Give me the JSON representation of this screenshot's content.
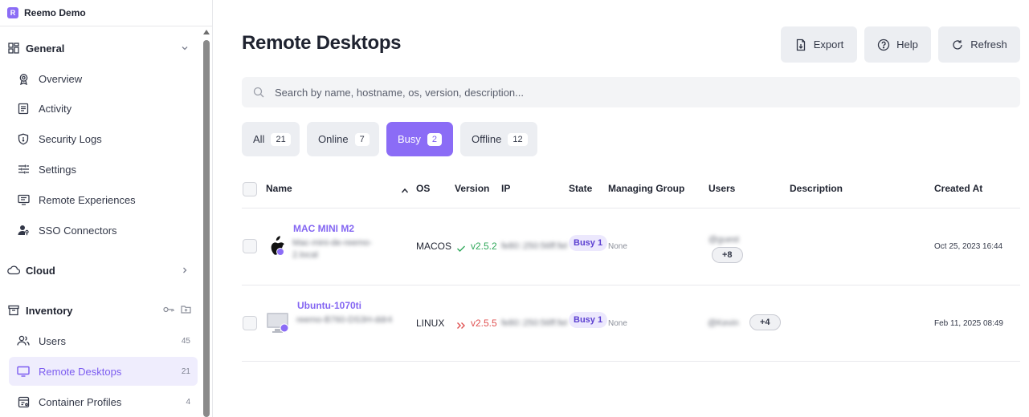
{
  "app": {
    "name": "Reemo Demo",
    "brand_color": "#8b6cf6"
  },
  "sidebar": {
    "general": {
      "label": "General",
      "items": [
        {
          "label": "Overview",
          "icon": "badge-icon"
        },
        {
          "label": "Activity",
          "icon": "document-list-icon"
        },
        {
          "label": "Security Logs",
          "icon": "shield-icon"
        },
        {
          "label": "Settings",
          "icon": "sliders-icon"
        },
        {
          "label": "Remote Experiences",
          "icon": "monitor-chat-icon"
        },
        {
          "label": "SSO Connectors",
          "icon": "user-key-icon"
        }
      ]
    },
    "cloud": {
      "label": "Cloud"
    },
    "inventory": {
      "label": "Inventory",
      "items": [
        {
          "label": "Users",
          "count": "45",
          "icon": "users-icon"
        },
        {
          "label": "Remote Desktops",
          "count": "21",
          "icon": "monitor-icon",
          "active": true
        },
        {
          "label": "Container Profiles",
          "count": "4",
          "icon": "container-icon"
        }
      ]
    }
  },
  "header": {
    "title": "Remote Desktops",
    "export_label": "Export",
    "help_label": "Help",
    "refresh_label": "Refresh"
  },
  "search": {
    "placeholder": "Search by name, hostname, os, version, description..."
  },
  "filters": [
    {
      "label": "All",
      "count": "21"
    },
    {
      "label": "Online",
      "count": "7"
    },
    {
      "label": "Busy",
      "count": "2",
      "active": true
    },
    {
      "label": "Offline",
      "count": "12"
    }
  ],
  "table": {
    "columns": {
      "name": "Name",
      "os": "OS",
      "version": "Version",
      "ip": "IP",
      "state": "State",
      "managing_group": "Managing Group",
      "users": "Users",
      "description": "Description",
      "created_at": "Created At"
    },
    "rows": [
      {
        "name": "MAC MINI M2",
        "hostname": "Mac-mini-de-reemo-2.local",
        "os": "MACOS",
        "version": "v2.5.2",
        "version_status": "up-to-date",
        "ip": "fe80::250:56ff:fe8b",
        "state": "Busy",
        "state_count": "1",
        "managing_group": "None",
        "user": "@guest",
        "extra_users": "+8",
        "created_at": "Oct 25, 2023 16:44"
      },
      {
        "name": "Ubuntu-1070ti",
        "hostname": "reemo-B760-DS3H-ddr4",
        "os": "LINUX",
        "version": "v2.5.5",
        "version_status": "outdated",
        "ip": "fe80::250:56ff:fe8b",
        "state": "Busy",
        "state_count": "1",
        "managing_group": "None",
        "user": "@Kevin",
        "extra_users": "+4",
        "created_at": "Feb 11, 2025 08:49"
      }
    ]
  }
}
